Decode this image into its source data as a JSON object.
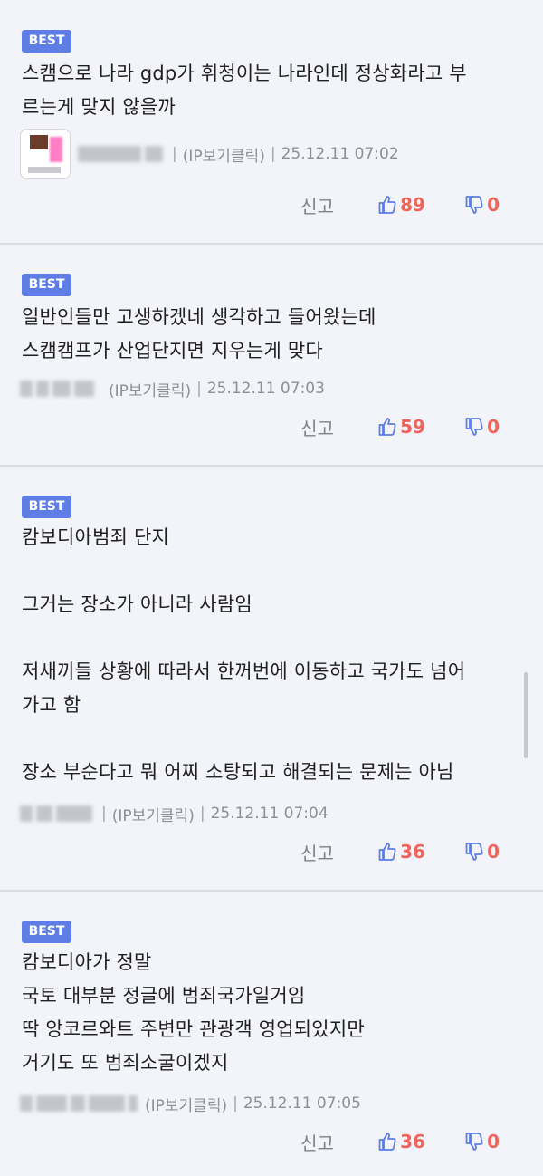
{
  "comments": [
    {
      "badge": "BEST",
      "text": "스캠으로 나라 gdp가 휘청이는 나라인데 정상화라고 부\n르는게 맞지 않을까",
      "source": "(IP보기클릭)",
      "datetime": "25.12.11 07:02",
      "report": "신고",
      "likes": "89",
      "dislikes": "0"
    },
    {
      "badge": "BEST",
      "text": "일반인들만 고생하겠네 생각하고 들어왔는데\n스캠캠프가 산업단지면 지우는게 맞다",
      "source": "(IP보기클릭)",
      "datetime": "25.12.11 07:03",
      "report": "신고",
      "likes": "59",
      "dislikes": "0"
    },
    {
      "badge": "BEST",
      "text": "캄보디아범죄 단지\n\n그거는 장소가 아니라 사람임\n\n저새끼들 상황에 따라서 한꺼번에 이동하고 국가도 넘어\n가고 함\n\n장소 부순다고 뭐 어찌 소탕되고 해결되는 문제는 아님",
      "source": "(IP보기클릭)",
      "datetime": "25.12.11 07:04",
      "report": "신고",
      "likes": "36",
      "dislikes": "0"
    },
    {
      "badge": "BEST",
      "text": "캄보디아가 정말\n국토 대부분 정글에 범죄국가일거임\n딱 앙코르와트 주변만 관광객 영업되있지만\n거기도 또 범죄소굴이겠지",
      "source": "(IP보기클릭)",
      "datetime": "25.12.11 07:05",
      "report": "신고",
      "likes": "36",
      "dislikes": "0"
    }
  ]
}
